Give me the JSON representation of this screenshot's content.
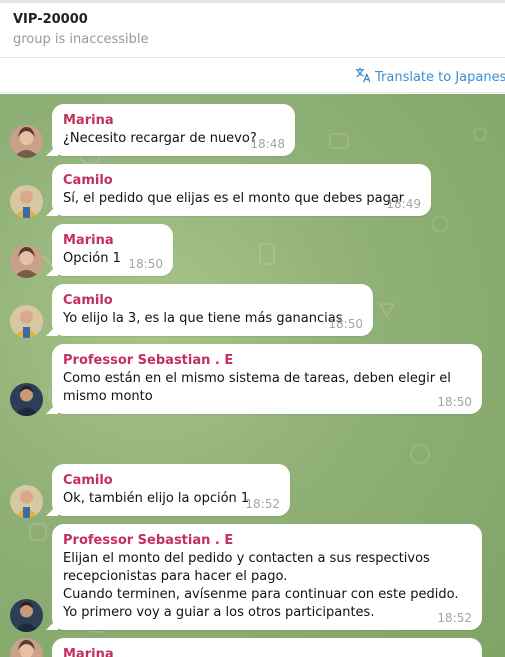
{
  "header": {
    "title": "VIP-20000",
    "status": "group is inaccessible"
  },
  "translate": {
    "label": "Translate to Japanese",
    "icon": "translate-icon"
  },
  "colors": {
    "translate": "#3a8fd0",
    "marina": "#c2315a",
    "camilo": "#c2315a",
    "professor": "#c2315a",
    "timestamp": "#a0a8a0"
  },
  "messages": [
    {
      "sender": "Marina",
      "text": "¿Necesito recargar de nuevo?",
      "time": "18:48"
    },
    {
      "sender": "Camilo",
      "text": "Sí, el pedido que elijas es el monto que debes pagar",
      "time": "18:49"
    },
    {
      "sender": "Marina",
      "text": "Opción 1",
      "time": "18:50"
    },
    {
      "sender": "Camilo",
      "text": "Yo elijo la 3, es la que tiene más ganancias",
      "time": "18:50"
    },
    {
      "sender": "Professor Sebastian . E",
      "text": "Como están en el mismo sistema de tareas, deben elegir el mismo monto",
      "time": "18:50"
    },
    {
      "sender": "Camilo",
      "text": "Ok, también elijo la opción 1",
      "time": "18:52"
    },
    {
      "sender": "Professor Sebastian . E",
      "text": "Elijan el monto del pedido y contacten a sus respectivos recepcionistas para hacer el pago.\nCuando terminen, avísenme para continuar con este pedido. Yo primero voy a guiar a los otros participantes.",
      "time": "18:52"
    },
    {
      "sender": "Marina",
      "text": "",
      "time": ""
    }
  ]
}
